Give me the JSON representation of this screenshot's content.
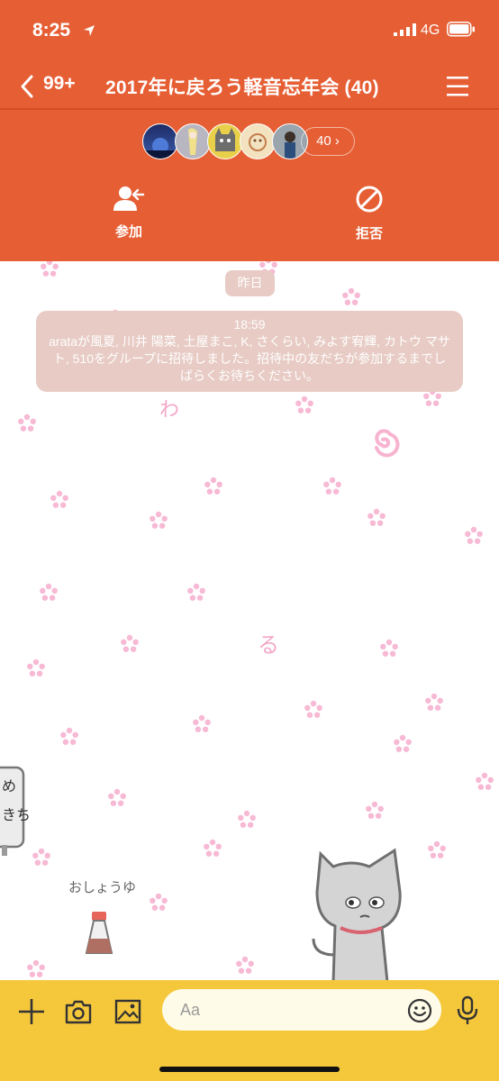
{
  "status": {
    "time": "8:25",
    "network": "4G"
  },
  "nav": {
    "back_count": "99+",
    "title": "2017年に戻ろう軽音忘年会 (40)"
  },
  "members": {
    "count_label": "40 ›"
  },
  "actions": {
    "join_label": "参加",
    "reject_label": "拒否"
  },
  "chat": {
    "date_label": "昨日",
    "system_message": {
      "time": "18:59",
      "text": "arataが風夏, 川井 陽菜, 土屋まこ, K, さくらい, みよす宥輝, カトウ マサト, 510をグループに招待しました。招待中の友だちが参加するまでしばらくお待ちください。"
    },
    "stickers": {
      "sign_text": "めきち",
      "shoyu_label": "おしょうゆ",
      "letters": [
        "わ",
        "る"
      ]
    }
  },
  "composer": {
    "placeholder": "Aa"
  },
  "colors": {
    "header": "#e65e34",
    "bottom_bar": "#f5c83c",
    "chip": "#e7cbc4",
    "petal": "#f7b9d4"
  }
}
